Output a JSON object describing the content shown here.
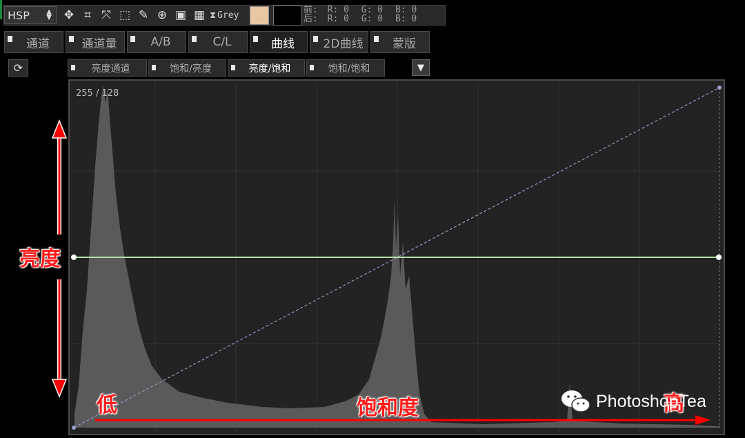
{
  "toolbar": {
    "mode": "HSP",
    "grey_label": "Grey",
    "fg_color": "#e8c6a3",
    "bg_color": "#000000",
    "readout": {
      "front_label": "前:",
      "back_label": "后:",
      "front": {
        "r": "R: 0",
        "g": "G: 0",
        "b": "B: 0"
      },
      "back": {
        "r": "R: 0",
        "g": "G: 0",
        "b": "B: 0"
      }
    }
  },
  "tabs": [
    "通道",
    "通道量",
    "A/B",
    "C/L",
    "曲线",
    "2D曲线",
    "蒙版"
  ],
  "subtabs": [
    "亮度通道",
    "饱和/亮度",
    "亮度/饱和",
    "饱和/饱和"
  ],
  "graph": {
    "readout": "255 / 128"
  },
  "annotations": {
    "vertical": "亮度",
    "low": "低",
    "middle": "饱和度",
    "high": "高"
  },
  "watermark": "PhotoshopTea",
  "colors": {
    "curve": "#b8e0a8",
    "arrow": "#ff0000",
    "histogram": "#5a5a5a",
    "diagonal": "#9090b8"
  }
}
